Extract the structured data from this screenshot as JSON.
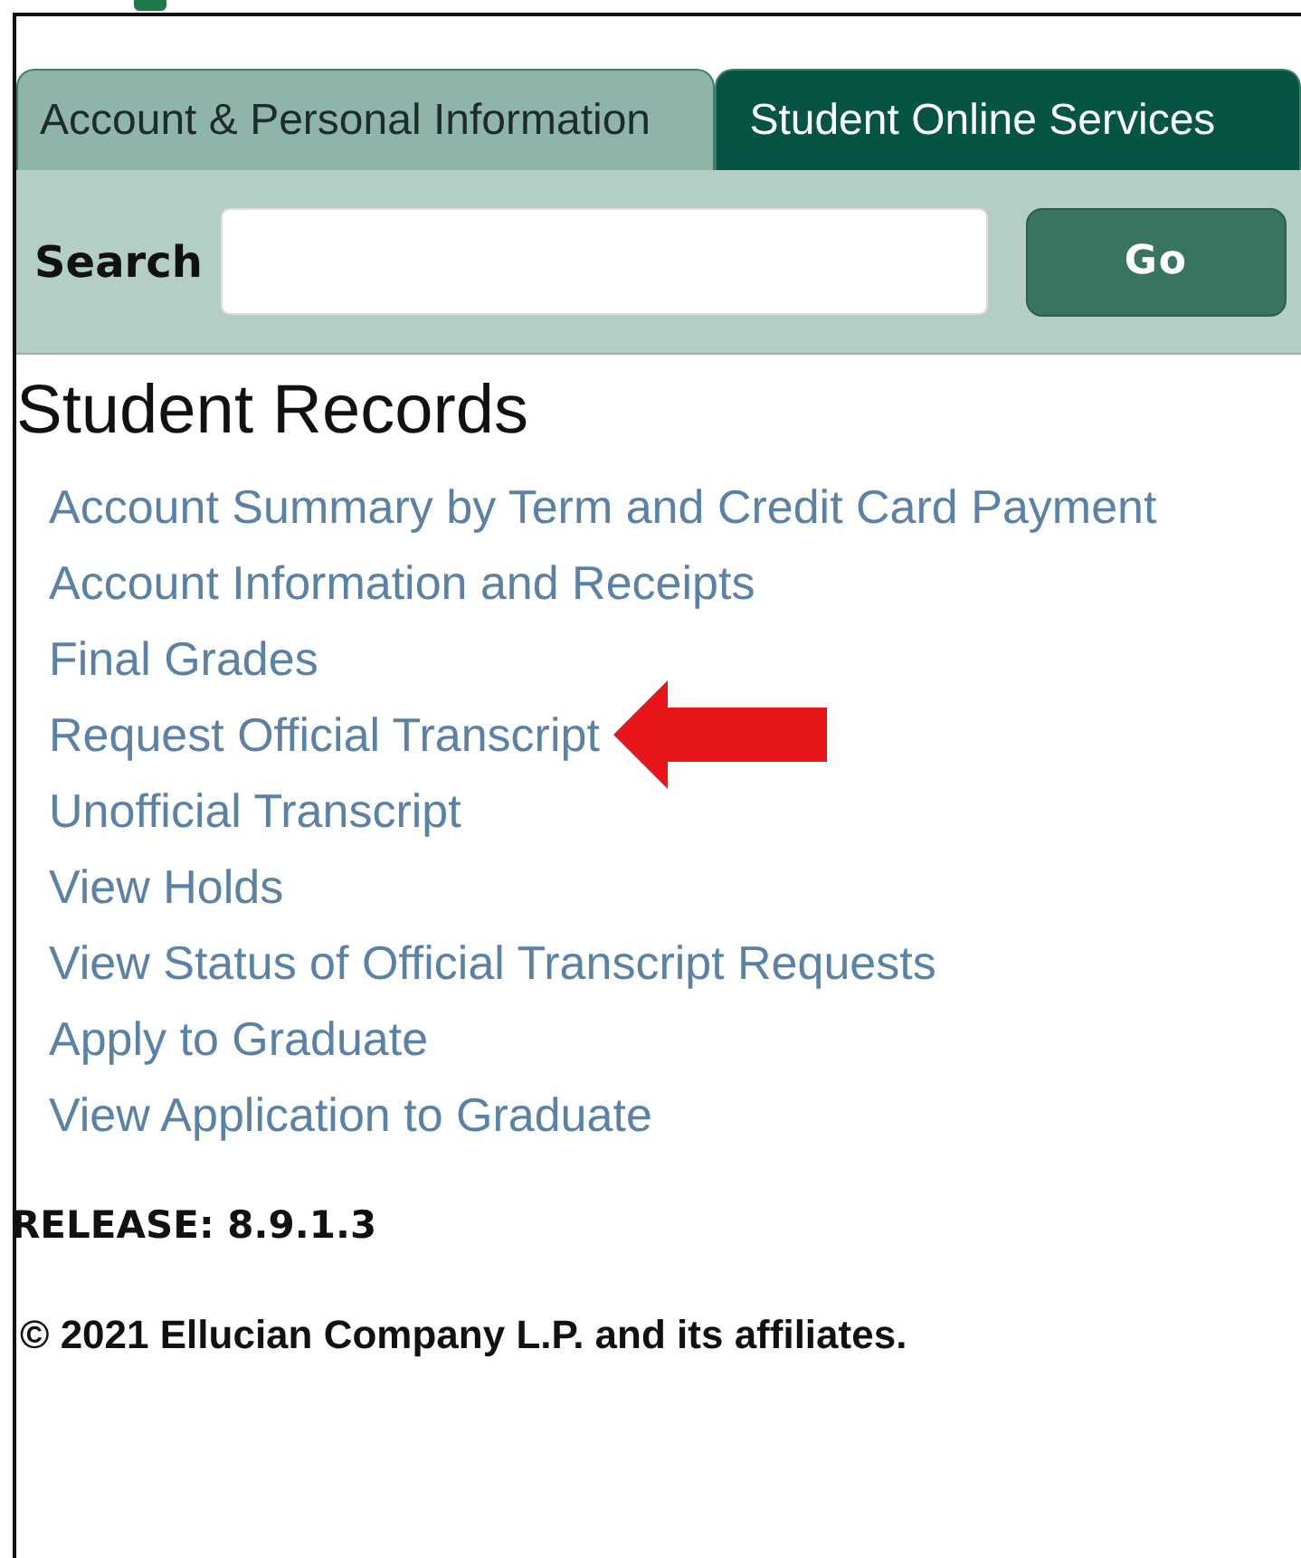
{
  "tabs": [
    {
      "label": "Account & Personal Information",
      "selected": false
    },
    {
      "label": "Student Online Services",
      "selected": true
    }
  ],
  "search": {
    "label": "Search",
    "button": "Go"
  },
  "heading": "Student Records",
  "links": [
    {
      "label": "Account Summary by Term and Credit Card Payment",
      "highlighted": false
    },
    {
      "label": "Account Information and Receipts",
      "highlighted": false
    },
    {
      "label": "Final Grades",
      "highlighted": false
    },
    {
      "label": "Request Official Transcript",
      "highlighted": true
    },
    {
      "label": "Unofficial Transcript",
      "highlighted": false
    },
    {
      "label": "View Holds",
      "highlighted": false
    },
    {
      "label": "View Status of Official Transcript Requests",
      "highlighted": false
    },
    {
      "label": "Apply to Graduate",
      "highlighted": false
    },
    {
      "label": "View Application to Graduate",
      "highlighted": false
    }
  ],
  "release": "RELEASE: 8.9.1.3",
  "copyright": "© 2021 Ellucian Company L.P. and its affiliates."
}
